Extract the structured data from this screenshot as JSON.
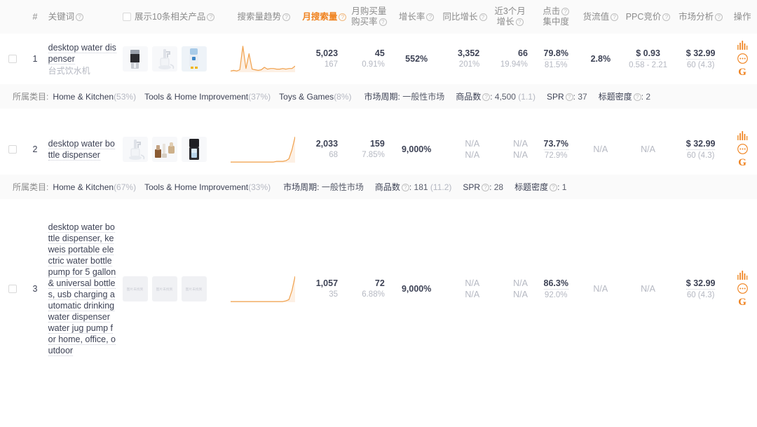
{
  "theme": {
    "accent": "#f0821e",
    "text_primary": "#3d4255",
    "text_muted": "#b5b8c2",
    "header_bg": "#fafafa"
  },
  "table": {
    "columns": [
      {
        "key": "checkbox",
        "label": "",
        "icon": "checkbox-icon",
        "help": false
      },
      {
        "key": "index",
        "label": "#",
        "help": false
      },
      {
        "key": "keyword",
        "label": "关键词",
        "help": true
      },
      {
        "key": "related_products",
        "label": "展示10条相关产品",
        "help": true,
        "checkbox": true
      },
      {
        "key": "search_trend",
        "label": "搜索量趋势",
        "help": true
      },
      {
        "key": "monthly_search",
        "label": "月搜索量",
        "help": true,
        "highlight": true
      },
      {
        "key": "monthly_purchase",
        "label_line1": "月购买量",
        "label_line2": "购买率",
        "help": true
      },
      {
        "key": "growth_rate",
        "label": "增长率",
        "help": true
      },
      {
        "key": "yoy_growth",
        "label": "同比增长",
        "help": true
      },
      {
        "key": "three_month_growth",
        "label_line1": "近3个月",
        "label_line2": "增长",
        "help": true
      },
      {
        "key": "click_concentration",
        "label_line1": "点击",
        "label_line2": "集中度",
        "help": true
      },
      {
        "key": "supply_value",
        "label": "货流值",
        "help": true
      },
      {
        "key": "ppc_bid",
        "label": "PPC竞价",
        "help": true
      },
      {
        "key": "market_analysis",
        "label": "市场分析",
        "help": true
      },
      {
        "key": "operation",
        "label": "操作",
        "help": false
      }
    ],
    "help_glyph": "?",
    "rows": [
      {
        "index": "1",
        "keyword_en": "desktop water dispenser",
        "keyword_cn": "台式饮水机",
        "thumbs": [
          {
            "placeholder": false,
            "kind": "black-bottle-dispenser"
          },
          {
            "placeholder": false,
            "kind": "white-pump-dispenser"
          },
          {
            "placeholder": false,
            "kind": "blue-water-cooler"
          }
        ],
        "trend": {
          "points": [
            2,
            3,
            2,
            4,
            42,
            6,
            30,
            5,
            4,
            3,
            4,
            8,
            5,
            6,
            6,
            5,
            5,
            6,
            5,
            6,
            6,
            10
          ],
          "max": 42
        },
        "monthly_search": {
          "main": "5,023",
          "sub": "167"
        },
        "monthly_purchase": {
          "main": "45",
          "sub": "0.91%"
        },
        "growth_rate": "552%",
        "yoy_growth": {
          "main": "3,352",
          "sub": "201%"
        },
        "three_month_growth": {
          "main": "66",
          "sub": "19.94%"
        },
        "click_concentration": {
          "main": "79.8%",
          "sub": "81.5%"
        },
        "supply_value": "2.8%",
        "ppc_bid": {
          "main": "$ 0.93",
          "sub": "0.58 - 2.21"
        },
        "market_analysis": {
          "main": "$ 32.99",
          "sub": "60 (4.3)"
        },
        "actions": [
          {
            "name": "bar-chart-icon",
            "label": ""
          },
          {
            "name": "ellipsis-circle-icon",
            "label": ""
          },
          {
            "name": "google-icon",
            "label": "G"
          }
        ],
        "meta": {
          "category_label": "所属类目:",
          "categories": [
            {
              "name": "Home & Kitchen",
              "pct": "(53%)"
            },
            {
              "name": "Tools & Home Improvement",
              "pct": "(37%)"
            },
            {
              "name": "Toys & Games",
              "pct": "(8%)"
            }
          ],
          "market_cycle_label": "市场周期:",
          "market_cycle_value": "一般性市场",
          "product_count_label": "商品数",
          "product_count_value": "4,500",
          "product_count_extra": "(1.1)",
          "spr_label": "SPR",
          "spr_value": "37",
          "title_density_label": "标题密度",
          "title_density_value": "2"
        }
      },
      {
        "index": "2",
        "keyword_en": "desktop water bottle dispenser",
        "keyword_cn": "",
        "thumbs": [
          {
            "placeholder": false,
            "kind": "white-pump-dispenser"
          },
          {
            "placeholder": false,
            "kind": "wood-coffee-set"
          },
          {
            "placeholder": false,
            "kind": "black-tower-dispenser"
          }
        ],
        "trend": {
          "points": [
            1,
            1,
            1,
            1,
            1,
            1,
            1,
            1,
            1,
            1,
            1,
            1,
            1,
            1,
            1,
            2,
            2,
            2,
            3,
            6,
            20,
            40
          ],
          "max": 40
        },
        "monthly_search": {
          "main": "2,033",
          "sub": "68"
        },
        "monthly_purchase": {
          "main": "159",
          "sub": "7.85%"
        },
        "growth_rate": "9,000%",
        "yoy_growth": {
          "main": "N/A",
          "sub": "N/A"
        },
        "three_month_growth": {
          "main": "N/A",
          "sub": "N/A"
        },
        "click_concentration": {
          "main": "73.7%",
          "sub": "72.9%"
        },
        "supply_value": "N/A",
        "ppc_bid": {
          "main": "N/A",
          "sub": ""
        },
        "market_analysis": {
          "main": "$ 32.99",
          "sub": "60 (4.3)"
        },
        "actions": [
          {
            "name": "bar-chart-icon",
            "label": ""
          },
          {
            "name": "ellipsis-circle-icon",
            "label": ""
          },
          {
            "name": "google-icon",
            "label": "G"
          }
        ],
        "meta": {
          "category_label": "所属类目:",
          "categories": [
            {
              "name": "Home & Kitchen",
              "pct": "(67%)"
            },
            {
              "name": "Tools & Home Improvement",
              "pct": "(33%)"
            }
          ],
          "market_cycle_label": "市场周期:",
          "market_cycle_value": "一般性市场",
          "product_count_label": "商品数",
          "product_count_value": "181",
          "product_count_extra": "(11.2)",
          "spr_label": "SPR",
          "spr_value": "28",
          "title_density_label": "标题密度",
          "title_density_value": "1"
        }
      },
      {
        "index": "3",
        "keyword_en": "desktop water bottle dispenser, keweis portable electric water bottle pump for 5 gallon & universal bottles, usb charging automatic drinking water dispenser water jug pump for home, office, outdoor",
        "keyword_cn": "",
        "thumbs": [
          {
            "placeholder": true,
            "label": "图片未找到"
          },
          {
            "placeholder": true,
            "label": "图片未找到"
          },
          {
            "placeholder": true,
            "label": "图片未找到"
          }
        ],
        "trend": {
          "points": [
            1,
            1,
            1,
            1,
            1,
            1,
            1,
            1,
            1,
            1,
            1,
            1,
            1,
            1,
            1,
            1,
            1,
            1,
            2,
            4,
            18,
            40
          ],
          "max": 40
        },
        "monthly_search": {
          "main": "1,057",
          "sub": "35"
        },
        "monthly_purchase": {
          "main": "72",
          "sub": "6.88%"
        },
        "growth_rate": "9,000%",
        "yoy_growth": {
          "main": "N/A",
          "sub": "N/A"
        },
        "three_month_growth": {
          "main": "N/A",
          "sub": "N/A"
        },
        "click_concentration": {
          "main": "86.3%",
          "sub": "92.0%"
        },
        "supply_value": "N/A",
        "ppc_bid": {
          "main": "N/A",
          "sub": ""
        },
        "market_analysis": {
          "main": "$ 32.99",
          "sub": "60 (4.3)"
        },
        "actions": [
          {
            "name": "bar-chart-icon",
            "label": ""
          },
          {
            "name": "ellipsis-circle-icon",
            "label": ""
          },
          {
            "name": "google-icon",
            "label": "G"
          }
        ],
        "meta": null
      }
    ]
  }
}
